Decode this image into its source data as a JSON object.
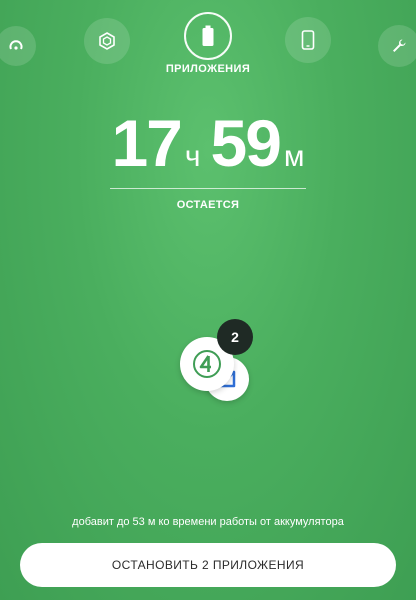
{
  "nav": {
    "active_label": "ПРИЛОЖЕНИЯ",
    "items": [
      {
        "icon": "gauge-icon"
      },
      {
        "icon": "optimize-icon"
      },
      {
        "icon": "battery-icon"
      },
      {
        "icon": "phone-icon"
      },
      {
        "icon": "wrench-icon"
      }
    ]
  },
  "time_remaining": {
    "hours": "17",
    "hours_unit": "ч",
    "minutes": "59",
    "minutes_unit": "м",
    "label": "ОСТАЕТСЯ"
  },
  "apps": {
    "count": "2",
    "icons": [
      "app-4-icon",
      "app-blue-icon"
    ]
  },
  "hint_text": "добавит до 53 м ко времени работы от аккумулятора",
  "stop_button_label": "ОСТАНОВИТЬ 2 ПРИЛОЖЕНИЯ",
  "colors": {
    "background": "#4aae5e",
    "badge": "#1f2a25",
    "app_icon_green": "#3f9d55",
    "app_icon_blue": "#2f6fd6"
  }
}
